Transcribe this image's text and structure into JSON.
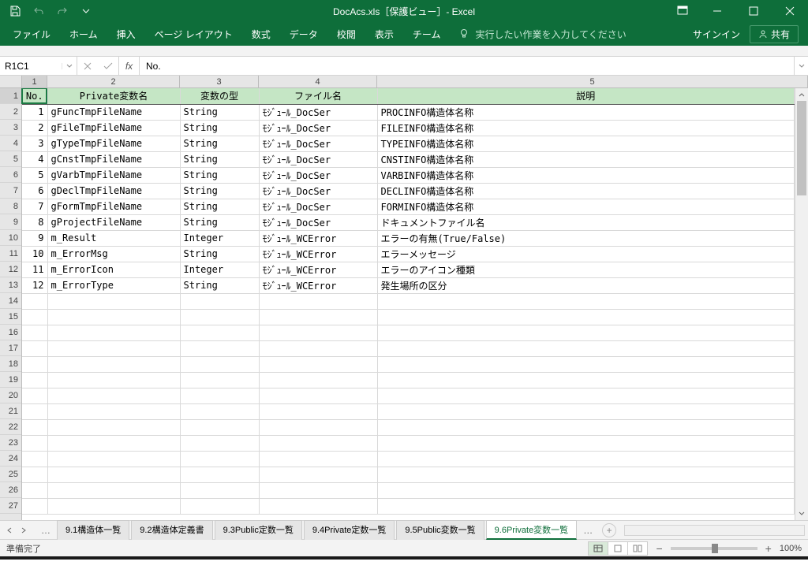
{
  "window": {
    "title": "DocAcs.xls［保護ビュー］- Excel"
  },
  "ribbon": {
    "tabs": [
      "ファイル",
      "ホーム",
      "挿入",
      "ページ レイアウト",
      "数式",
      "データ",
      "校閲",
      "表示",
      "チーム"
    ],
    "tell_me": "実行したい作業を入力してください",
    "sign_in": "サインイン",
    "share": "共有"
  },
  "formula_bar": {
    "name_box": "R1C1",
    "formula": "No."
  },
  "columns": {
    "nums": [
      "1",
      "2",
      "3",
      "4",
      "5"
    ],
    "widths": [
      32,
      168,
      100,
      150,
      520
    ]
  },
  "headers": [
    "No.",
    "Private変数名",
    "変数の型",
    "ファイル名",
    "説明"
  ],
  "rows": [
    {
      "no": "1",
      "name": "gFuncTmpFileName",
      "type": "String",
      "file": "ﾓｼﾞｭｰﾙ_DocSer",
      "desc": "PROCINFO構造体名称"
    },
    {
      "no": "2",
      "name": "gFileTmpFileName",
      "type": "String",
      "file": "ﾓｼﾞｭｰﾙ_DocSer",
      "desc": "FILEINFO構造体名称"
    },
    {
      "no": "3",
      "name": "gTypeTmpFileName",
      "type": "String",
      "file": "ﾓｼﾞｭｰﾙ_DocSer",
      "desc": "TYPEINFO構造体名称"
    },
    {
      "no": "4",
      "name": "gCnstTmpFileName",
      "type": "String",
      "file": "ﾓｼﾞｭｰﾙ_DocSer",
      "desc": "CNSTINFO構造体名称"
    },
    {
      "no": "5",
      "name": "gVarbTmpFileName",
      "type": "String",
      "file": "ﾓｼﾞｭｰﾙ_DocSer",
      "desc": "VARBINFO構造体名称"
    },
    {
      "no": "6",
      "name": "gDeclTmpFileName",
      "type": "String",
      "file": "ﾓｼﾞｭｰﾙ_DocSer",
      "desc": "DECLINFO構造体名称"
    },
    {
      "no": "7",
      "name": "gFormTmpFileName",
      "type": "String",
      "file": "ﾓｼﾞｭｰﾙ_DocSer",
      "desc": "FORMINFO構造体名称"
    },
    {
      "no": "8",
      "name": "gProjectFileName",
      "type": "String",
      "file": "ﾓｼﾞｭｰﾙ_DocSer",
      "desc": "ドキュメントファイル名"
    },
    {
      "no": "9",
      "name": "m_Result",
      "type": "Integer",
      "file": "ﾓｼﾞｭｰﾙ_WCError",
      "desc": "エラーの有無(True/False)"
    },
    {
      "no": "10",
      "name": "m_ErrorMsg",
      "type": "String",
      "file": "ﾓｼﾞｭｰﾙ_WCError",
      "desc": "エラーメッセージ"
    },
    {
      "no": "11",
      "name": "m_ErrorIcon",
      "type": "Integer",
      "file": "ﾓｼﾞｭｰﾙ_WCError",
      "desc": "エラーのアイコン種類"
    },
    {
      "no": "12",
      "name": "m_ErrorType",
      "type": "String",
      "file": "ﾓｼﾞｭｰﾙ_WCError",
      "desc": "発生場所の区分"
    }
  ],
  "empty_row_count": 14,
  "row_numbers_start": 1,
  "row_numbers_end": 27,
  "sheet_tabs": {
    "items": [
      "9.1構造体一覧",
      "9.2構造体定義書",
      "9.3Public定数一覧",
      "9.4Private定数一覧",
      "9.5Public変数一覧",
      "9.6Private変数一覧"
    ],
    "active_index": 5
  },
  "status": {
    "ready": "準備完了",
    "zoom": "100%"
  }
}
